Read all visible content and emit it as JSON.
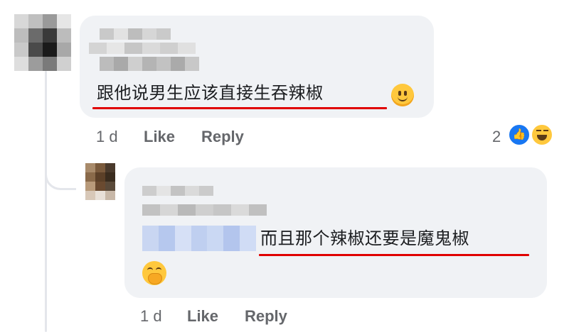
{
  "comment": {
    "author": "",
    "text": "跟他说男生应该直接生吞辣椒",
    "emoji": "slightly-smiling-face",
    "time": "1 d",
    "like_label": "Like",
    "reply_label": "Reply",
    "reaction_count": "2",
    "reactions": [
      "like",
      "haha"
    ]
  },
  "reply": {
    "author": "",
    "text": "而且那个辣椒还要是魔鬼椒",
    "emoji": "face-with-hand-over-mouth",
    "time": "1 d",
    "like_label": "Like",
    "reply_label": "Reply"
  },
  "colors": {
    "bubble": "#f0f2f5",
    "underline": "#e00000",
    "like_blue": "#1877f2",
    "meta_gray": "#65676b"
  },
  "icons": [
    "avatar-blurred",
    "slightly-smiling-face-icon",
    "like-reaction-icon",
    "haha-reaction-icon",
    "hand-over-mouth-icon"
  ]
}
